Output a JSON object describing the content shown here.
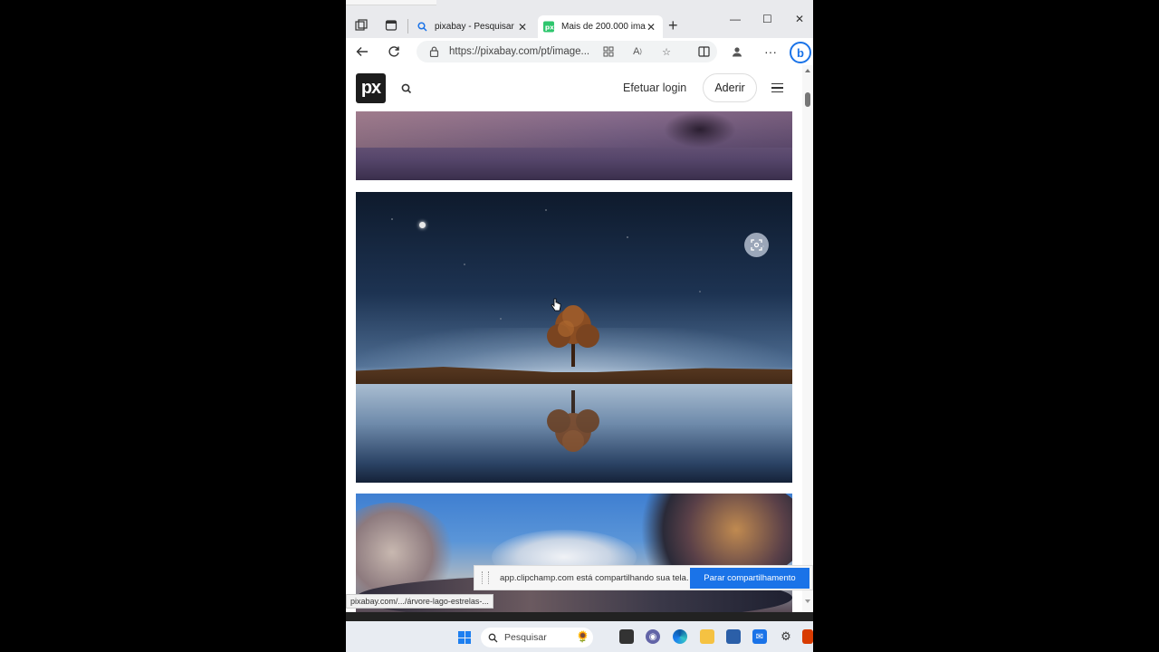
{
  "browser": {
    "tabs": [
      {
        "label": "pixabay - Pesquisar",
        "icon": "search-icon",
        "active": false
      },
      {
        "label": "Mais de 200.000 ima",
        "icon": "pixabay-favicon",
        "active": true
      }
    ],
    "address": {
      "url_host": "https://pixabay.com",
      "url_path": "/pt/image..."
    },
    "window_controls": [
      "minimize",
      "maximize",
      "close"
    ]
  },
  "site": {
    "logo_text": "px",
    "login_label": "Efetuar login",
    "join_label": "Aderir"
  },
  "sharing_bar": {
    "message": "app.clipchamp.com está compartilhando sua tela.",
    "stop_label": "Parar compartilhamento"
  },
  "status_url": "pixabay.com/.../árvore-lago-estrelas-...",
  "taskbar": {
    "search_placeholder": "Pesquisar",
    "apps": [
      "task-view",
      "chat",
      "edge",
      "file-explorer",
      "store",
      "mail",
      "settings",
      "office"
    ]
  },
  "colors": {
    "accent": "#1a73e8",
    "tab_active_bg": "#ffffff",
    "tabstrip_bg": "#e9eaed"
  }
}
